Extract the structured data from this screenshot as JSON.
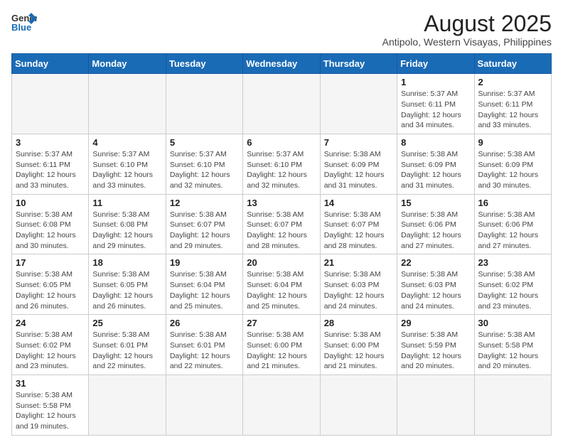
{
  "header": {
    "logo_general": "General",
    "logo_blue": "Blue",
    "month_year": "August 2025",
    "location": "Antipolo, Western Visayas, Philippines"
  },
  "days_of_week": [
    "Sunday",
    "Monday",
    "Tuesday",
    "Wednesday",
    "Thursday",
    "Friday",
    "Saturday"
  ],
  "weeks": [
    [
      {
        "day": "",
        "info": ""
      },
      {
        "day": "",
        "info": ""
      },
      {
        "day": "",
        "info": ""
      },
      {
        "day": "",
        "info": ""
      },
      {
        "day": "",
        "info": ""
      },
      {
        "day": "1",
        "info": "Sunrise: 5:37 AM\nSunset: 6:11 PM\nDaylight: 12 hours and 34 minutes."
      },
      {
        "day": "2",
        "info": "Sunrise: 5:37 AM\nSunset: 6:11 PM\nDaylight: 12 hours and 33 minutes."
      }
    ],
    [
      {
        "day": "3",
        "info": "Sunrise: 5:37 AM\nSunset: 6:11 PM\nDaylight: 12 hours and 33 minutes."
      },
      {
        "day": "4",
        "info": "Sunrise: 5:37 AM\nSunset: 6:10 PM\nDaylight: 12 hours and 33 minutes."
      },
      {
        "day": "5",
        "info": "Sunrise: 5:37 AM\nSunset: 6:10 PM\nDaylight: 12 hours and 32 minutes."
      },
      {
        "day": "6",
        "info": "Sunrise: 5:37 AM\nSunset: 6:10 PM\nDaylight: 12 hours and 32 minutes."
      },
      {
        "day": "7",
        "info": "Sunrise: 5:38 AM\nSunset: 6:09 PM\nDaylight: 12 hours and 31 minutes."
      },
      {
        "day": "8",
        "info": "Sunrise: 5:38 AM\nSunset: 6:09 PM\nDaylight: 12 hours and 31 minutes."
      },
      {
        "day": "9",
        "info": "Sunrise: 5:38 AM\nSunset: 6:09 PM\nDaylight: 12 hours and 30 minutes."
      }
    ],
    [
      {
        "day": "10",
        "info": "Sunrise: 5:38 AM\nSunset: 6:08 PM\nDaylight: 12 hours and 30 minutes."
      },
      {
        "day": "11",
        "info": "Sunrise: 5:38 AM\nSunset: 6:08 PM\nDaylight: 12 hours and 29 minutes."
      },
      {
        "day": "12",
        "info": "Sunrise: 5:38 AM\nSunset: 6:07 PM\nDaylight: 12 hours and 29 minutes."
      },
      {
        "day": "13",
        "info": "Sunrise: 5:38 AM\nSunset: 6:07 PM\nDaylight: 12 hours and 28 minutes."
      },
      {
        "day": "14",
        "info": "Sunrise: 5:38 AM\nSunset: 6:07 PM\nDaylight: 12 hours and 28 minutes."
      },
      {
        "day": "15",
        "info": "Sunrise: 5:38 AM\nSunset: 6:06 PM\nDaylight: 12 hours and 27 minutes."
      },
      {
        "day": "16",
        "info": "Sunrise: 5:38 AM\nSunset: 6:06 PM\nDaylight: 12 hours and 27 minutes."
      }
    ],
    [
      {
        "day": "17",
        "info": "Sunrise: 5:38 AM\nSunset: 6:05 PM\nDaylight: 12 hours and 26 minutes."
      },
      {
        "day": "18",
        "info": "Sunrise: 5:38 AM\nSunset: 6:05 PM\nDaylight: 12 hours and 26 minutes."
      },
      {
        "day": "19",
        "info": "Sunrise: 5:38 AM\nSunset: 6:04 PM\nDaylight: 12 hours and 25 minutes."
      },
      {
        "day": "20",
        "info": "Sunrise: 5:38 AM\nSunset: 6:04 PM\nDaylight: 12 hours and 25 minutes."
      },
      {
        "day": "21",
        "info": "Sunrise: 5:38 AM\nSunset: 6:03 PM\nDaylight: 12 hours and 24 minutes."
      },
      {
        "day": "22",
        "info": "Sunrise: 5:38 AM\nSunset: 6:03 PM\nDaylight: 12 hours and 24 minutes."
      },
      {
        "day": "23",
        "info": "Sunrise: 5:38 AM\nSunset: 6:02 PM\nDaylight: 12 hours and 23 minutes."
      }
    ],
    [
      {
        "day": "24",
        "info": "Sunrise: 5:38 AM\nSunset: 6:02 PM\nDaylight: 12 hours and 23 minutes."
      },
      {
        "day": "25",
        "info": "Sunrise: 5:38 AM\nSunset: 6:01 PM\nDaylight: 12 hours and 22 minutes."
      },
      {
        "day": "26",
        "info": "Sunrise: 5:38 AM\nSunset: 6:01 PM\nDaylight: 12 hours and 22 minutes."
      },
      {
        "day": "27",
        "info": "Sunrise: 5:38 AM\nSunset: 6:00 PM\nDaylight: 12 hours and 21 minutes."
      },
      {
        "day": "28",
        "info": "Sunrise: 5:38 AM\nSunset: 6:00 PM\nDaylight: 12 hours and 21 minutes."
      },
      {
        "day": "29",
        "info": "Sunrise: 5:38 AM\nSunset: 5:59 PM\nDaylight: 12 hours and 20 minutes."
      },
      {
        "day": "30",
        "info": "Sunrise: 5:38 AM\nSunset: 5:58 PM\nDaylight: 12 hours and 20 minutes."
      }
    ],
    [
      {
        "day": "31",
        "info": "Sunrise: 5:38 AM\nSunset: 5:58 PM\nDaylight: 12 hours and 19 minutes."
      },
      {
        "day": "",
        "info": ""
      },
      {
        "day": "",
        "info": ""
      },
      {
        "day": "",
        "info": ""
      },
      {
        "day": "",
        "info": ""
      },
      {
        "day": "",
        "info": ""
      },
      {
        "day": "",
        "info": ""
      }
    ]
  ]
}
